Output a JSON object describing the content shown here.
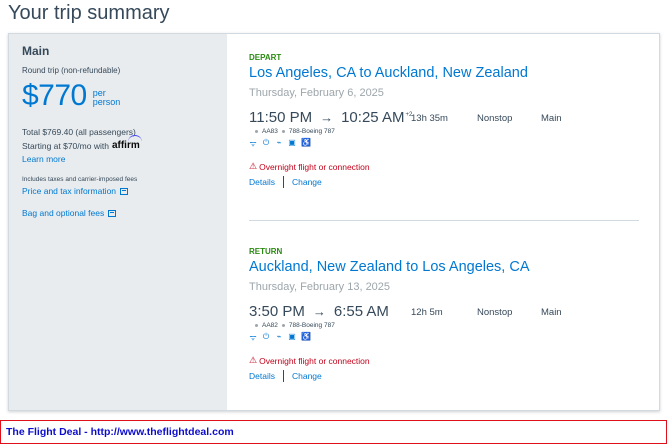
{
  "page": {
    "title": "Your trip summary"
  },
  "summary": {
    "title": "Main",
    "subtitle": "Round trip (non-refundable)",
    "price": "$770",
    "per_line1": "per",
    "per_line2": "person",
    "total": "Total $769.40 (all passengers)",
    "affirm_text": "Starting at $70/mo with",
    "affirm_brand": "affirm",
    "learn_more": "Learn more",
    "taxes_note": "Includes taxes and carrier-imposed fees",
    "price_tax_link": "Price and tax information",
    "bag_link": "Bag and optional fees"
  },
  "depart": {
    "label": "DEPART",
    "route": "Los Angeles, CA to Auckland, New Zealand",
    "date": "Thursday, February 6, 2025",
    "dep_time": "11:50 PM",
    "arrow": "→",
    "arr_time": "10:25 AM",
    "day_offset": "+2",
    "duration": "13h 35m",
    "stops": "Nonstop",
    "cabin": "Main",
    "flight_number": "AA83",
    "aircraft": "788-Boeing 787",
    "warning": "Overnight flight or connection",
    "details": "Details",
    "change": "Change"
  },
  "return": {
    "label": "RETURN",
    "route": "Auckland, New Zealand to Los Angeles, CA",
    "date": "Thursday, February 13, 2025",
    "dep_time": "3:50 PM",
    "arrow": "→",
    "arr_time": "6:55 AM",
    "duration": "12h 5m",
    "stops": "Nonstop",
    "cabin": "Main",
    "flight_number": "AA82",
    "aircraft": "788-Boeing 787",
    "warning": "Overnight flight or connection",
    "details": "Details",
    "change": "Change"
  },
  "amenity_icons": [
    "wifi-icon",
    "power-icon",
    "usb-icon",
    "entertainment-icon",
    "accessibility-icon"
  ],
  "colors": {
    "accent": "#0078d2",
    "label_green": "#2b8a12",
    "warning_red": "#c30019",
    "sidebar_bg": "#e8ecee"
  },
  "footer": {
    "text": "The Flight Deal - http://www.theflightdeal.com"
  }
}
